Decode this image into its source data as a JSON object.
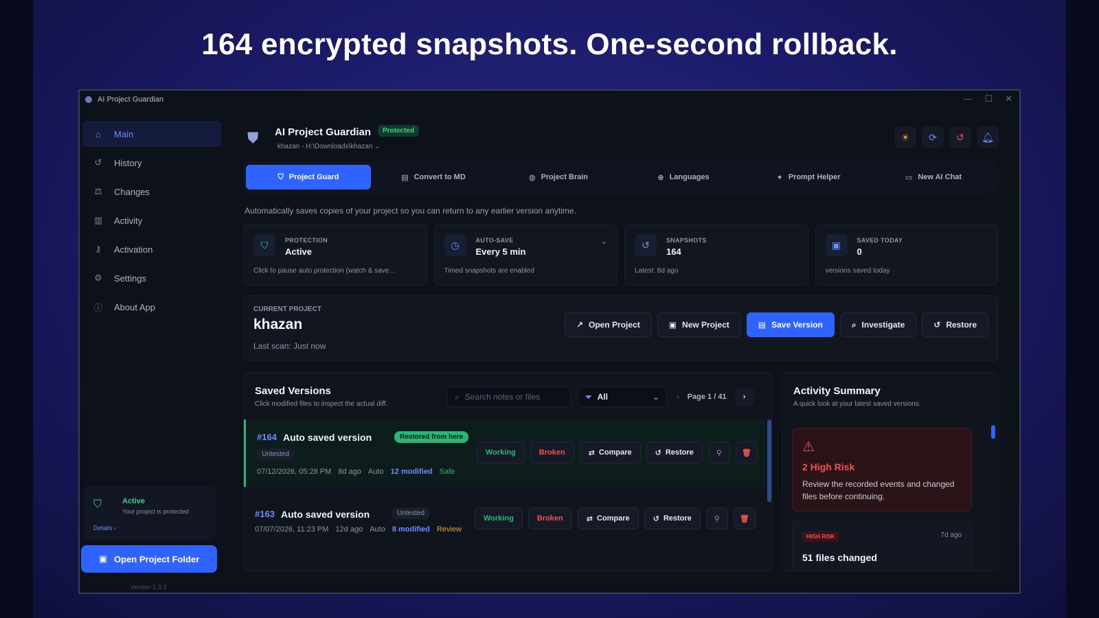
{
  "headline": "164 encrypted snapshots. One-second rollback.",
  "window": {
    "title": "AI Project Guardian"
  },
  "sidebar": {
    "items": [
      {
        "label": "Main",
        "icon": "home-icon"
      },
      {
        "label": "History",
        "icon": "history-icon"
      },
      {
        "label": "Changes",
        "icon": "scale-icon"
      },
      {
        "label": "Activity",
        "icon": "bar-chart-icon"
      },
      {
        "label": "Activation",
        "icon": "key-icon"
      },
      {
        "label": "Settings",
        "icon": "gear-icon"
      },
      {
        "label": "About App",
        "icon": "info-icon"
      }
    ],
    "status": {
      "title": "Active",
      "subtitle": "Your project is protected",
      "link": "Details"
    },
    "open_folder": "Open Project Folder",
    "version": "Version 1.3.3"
  },
  "header": {
    "title": "AI Project Guardian",
    "badge": "Protected",
    "path": "khazan - H:\\Downloads\\khazan"
  },
  "tabs": [
    {
      "label": "Project Guard",
      "icon": "shield-check-icon"
    },
    {
      "label": "Convert to MD",
      "icon": "document-icon"
    },
    {
      "label": "Project Brain",
      "icon": "brain-icon"
    },
    {
      "label": "Languages",
      "icon": "globe-icon"
    },
    {
      "label": "Prompt Helper",
      "icon": "wand-icon"
    },
    {
      "label": "New AI Chat",
      "icon": "chat-icon"
    }
  ],
  "description": "Automatically saves copies of your project so you can return to any earlier version anytime.",
  "stats": [
    {
      "label": "PROTECTION",
      "value": "Active",
      "sub": "Click to pause auto protection (watch & save..."
    },
    {
      "label": "AUTO-SAVE",
      "value": "Every 5 min",
      "sub": "Timed snapshots are enabled"
    },
    {
      "label": "SNAPSHOTS",
      "value": "164",
      "sub": "Latest: 8d ago"
    },
    {
      "label": "SAVED TODAY",
      "value": "0",
      "sub": "versions saved today"
    }
  ],
  "project": {
    "label": "CURRENT PROJECT",
    "name": "khazan",
    "scan": "Last scan: Just now",
    "actions": {
      "open": "Open Project",
      "new": "New Project",
      "save": "Save Version",
      "investigate": "Investigate",
      "restore": "Restore"
    }
  },
  "versions": {
    "title": "Saved Versions",
    "subtitle": "Click modified files to inspect the actual diff.",
    "search_placeholder": "Search notes or files",
    "filter": "All",
    "page": "Page 1 / 41",
    "rows": [
      {
        "num": "#164",
        "name": "Auto saved version",
        "restored": "Restored from here",
        "status": "Untested",
        "date": "07/12/2026, 05:28 PM",
        "ago": "8d ago",
        "type": "Auto",
        "modified": "12 modified",
        "safety": "Safe",
        "working": "Working",
        "broken": "Broken",
        "compare": "Compare",
        "restore": "Restore"
      },
      {
        "num": "#163",
        "name": "Auto saved version",
        "status": "Untested",
        "date": "07/07/2026, 11:23 PM",
        "ago": "12d ago",
        "type": "Auto",
        "modified": "8 modified",
        "safety": "Review",
        "working": "Working",
        "broken": "Broken",
        "compare": "Compare",
        "restore": "Restore"
      }
    ]
  },
  "summary": {
    "title": "Activity Summary",
    "subtitle": "A quick look at your latest saved versions.",
    "risk": {
      "title": "2 High Risk",
      "text": "Review the recorded events and changed files before continuing."
    },
    "event": {
      "badge": "HIGH RISK",
      "time": "7d ago",
      "title": "51 files changed"
    }
  },
  "colors": {
    "accent": "#2f63ff",
    "success": "#2bb673",
    "danger": "#f05252",
    "warning": "#e5a325"
  }
}
